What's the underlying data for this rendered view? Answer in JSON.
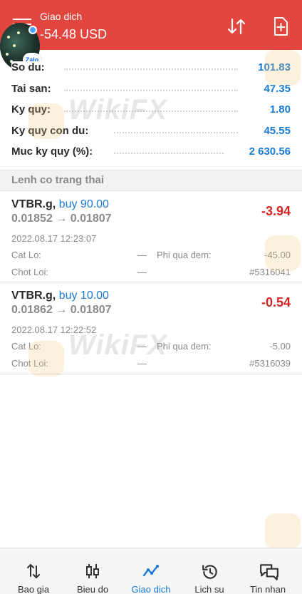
{
  "header": {
    "title": "Giao dich",
    "balance": "-54.48 USD",
    "avatar_badge": "Zalo"
  },
  "summary": [
    {
      "label": "So du:",
      "value": "101.83"
    },
    {
      "label": "Tai san:",
      "value": "47.35"
    },
    {
      "label": "Ky quy:",
      "value": "1.80"
    },
    {
      "label": "Ky quy con du:",
      "value": "45.55"
    },
    {
      "label": "Muc ky quy (%):",
      "value": "2 630.56"
    }
  ],
  "section_title": "Lenh co trang thai",
  "orders": [
    {
      "symbol": "VTBR.g,",
      "side": "buy 90.00",
      "price": "0.01852 → 0.01807",
      "profit": "-3.94",
      "time": "2022.08.17 12:23:07",
      "sl_label": "Cat Lo:",
      "sl_value": "—",
      "swap_label": "Phi qua dem:",
      "swap_value": "-45.00",
      "tp_label": "Chot Loi:",
      "tp_value": "—",
      "ticket": "#5316041"
    },
    {
      "symbol": "VTBR.g,",
      "side": "buy 10.00",
      "price": "0.01862 → 0.01807",
      "profit": "-0.54",
      "time": "2022.08.17 12:22:52",
      "sl_label": "Cat Lo:",
      "sl_value": "—",
      "swap_label": "Phi qua dem:",
      "swap_value": "-5.00",
      "tp_label": "Chot Loi:",
      "tp_value": "—",
      "ticket": "#5316039"
    }
  ],
  "watermark": "WikiFX",
  "nav": [
    {
      "label": "Bao gia",
      "icon": "quotes-arrows-icon"
    },
    {
      "label": "Bieu do",
      "icon": "candlestick-chart-icon"
    },
    {
      "label": "Giao dich",
      "icon": "trade-line-icon",
      "active": true
    },
    {
      "label": "Lich su",
      "icon": "history-clock-icon"
    },
    {
      "label": "Tin nhan",
      "icon": "messages-icon"
    }
  ],
  "colors": {
    "header": "#e2473f",
    "accent": "#1a7bd6",
    "loss": "#d32424"
  }
}
